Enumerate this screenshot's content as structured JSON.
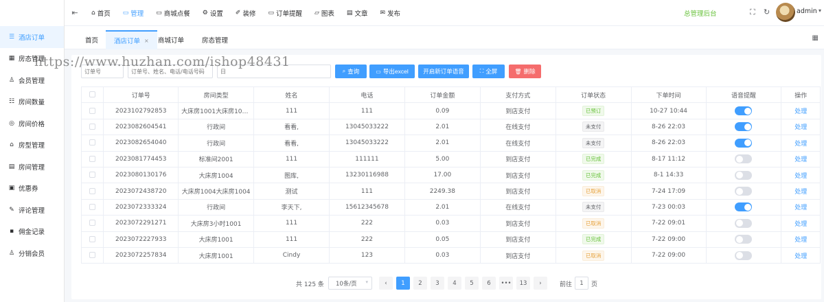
{
  "sidebar": {
    "items": [
      {
        "label": "酒店订单",
        "icon": "list-icon",
        "glyph": "☰",
        "active": true
      },
      {
        "label": "房态管理",
        "icon": "calendar-icon",
        "glyph": "▦",
        "active": false
      },
      {
        "label": "会员管理",
        "icon": "user-icon",
        "glyph": "♙",
        "active": false
      },
      {
        "label": "房间数量",
        "icon": "list-icon",
        "glyph": "☷",
        "active": false
      },
      {
        "label": "房间价格",
        "icon": "price-icon",
        "glyph": "◎",
        "active": false
      },
      {
        "label": "房型管理",
        "icon": "bank-icon",
        "glyph": "⌂",
        "active": false
      },
      {
        "label": "房间管理",
        "icon": "building-icon",
        "glyph": "▤",
        "active": false
      },
      {
        "label": "优惠券",
        "icon": "coupon-icon",
        "glyph": "▣",
        "active": false
      },
      {
        "label": "评论管理",
        "icon": "edit-icon",
        "glyph": "✎",
        "active": false
      },
      {
        "label": "佣金记录",
        "icon": "wallet-icon",
        "glyph": "▪",
        "active": false
      },
      {
        "label": "分销会员",
        "icon": "user-icon",
        "glyph": "♙",
        "active": false
      }
    ]
  },
  "topnav": {
    "collapse_glyph": "⇤",
    "items": [
      {
        "label": "首页",
        "icon": "home-icon",
        "glyph": "⌂"
      },
      {
        "label": "管理",
        "icon": "monitor-icon",
        "glyph": "▭",
        "active": true
      },
      {
        "label": "商城点餐",
        "icon": "message-icon",
        "glyph": "▭"
      },
      {
        "label": "设置",
        "icon": "gear-icon",
        "glyph": "⚙"
      },
      {
        "label": "装修",
        "icon": "brush-icon",
        "glyph": "✐"
      },
      {
        "label": "订单提醒",
        "icon": "bell-icon",
        "glyph": "▭"
      },
      {
        "label": "图表",
        "icon": "chart-icon",
        "glyph": "▱"
      },
      {
        "label": "文章",
        "icon": "document-icon",
        "glyph": "▤"
      },
      {
        "label": "发布",
        "icon": "wechat-icon",
        "glyph": "✉"
      }
    ],
    "brand": "总管理后台",
    "fullscreen_glyph": "⛶",
    "refresh_glyph": "↻",
    "user": "admin",
    "user_caret": "▾"
  },
  "tabs": {
    "items": [
      {
        "label": "首页",
        "active": false
      },
      {
        "label": "酒店订单",
        "active": true,
        "close": "×"
      },
      {
        "label": "商城订单",
        "active": false
      },
      {
        "label": "房态管理",
        "active": false
      }
    ],
    "grid_glyph": "▦"
  },
  "filters": {
    "order_no_placeholder": "订单号",
    "keyword_placeholder": "订单号、姓名、电话/电话号码",
    "date_placeholder": "日"
  },
  "buttons": {
    "query": "查询",
    "export": "导出excel",
    "voice": "开启新订单语音",
    "fullscreen": "全屏",
    "delete": "删除"
  },
  "watermark": "https://www.huzhan.com/ishop48431",
  "table": {
    "headers": [
      "订单号",
      "房间类型",
      "姓名",
      "电话",
      "订单金额",
      "支付方式",
      "订单状态",
      "下单时间",
      "语音提醒",
      "操作"
    ],
    "rows": [
      {
        "order_no": "2023102792853",
        "room": "大床房1001大床房1004...",
        "name": "111",
        "phone": "111",
        "amount": "0.09",
        "pay": "到店支付",
        "status": "已预订",
        "status_color": "green",
        "time": "10-27 10:44",
        "voice": true,
        "action": "处理"
      },
      {
        "order_no": "2023082604541",
        "room": "行政间",
        "name": "看看,",
        "phone": "13045033222",
        "amount": "2.01",
        "pay": "在线支付",
        "status": "未支付",
        "status_color": "gray",
        "time": "8-26 22:03",
        "voice": true,
        "action": "处理"
      },
      {
        "order_no": "2023082654040",
        "room": "行政间",
        "name": "看看,",
        "phone": "13045033222",
        "amount": "2.01",
        "pay": "在线支付",
        "status": "未支付",
        "status_color": "gray",
        "time": "8-26 22:03",
        "voice": true,
        "action": "处理"
      },
      {
        "order_no": "2023081774453",
        "room": "标准间2001",
        "name": "111",
        "phone": "111111",
        "amount": "5.00",
        "pay": "到店支付",
        "status": "已完成",
        "status_color": "green",
        "time": "8-17 11:12",
        "voice": false,
        "action": "处理"
      },
      {
        "order_no": "2023080130176",
        "room": "大床房1004",
        "name": "图库,",
        "phone": "13230116988",
        "amount": "17.00",
        "pay": "到店支付",
        "status": "已完成",
        "status_color": "green",
        "time": "8-1 14:33",
        "voice": false,
        "action": "处理"
      },
      {
        "order_no": "2023072438720",
        "room": "大床房1004大床房1004",
        "name": "测试",
        "phone": "111",
        "amount": "2249.38",
        "pay": "到店支付",
        "status": "已取消",
        "status_color": "orange",
        "time": "7-24 17:09",
        "voice": false,
        "action": "处理"
      },
      {
        "order_no": "2023072333324",
        "room": "行政间",
        "name": "李天下,",
        "phone": "15612345678",
        "amount": "2.01",
        "pay": "在线支付",
        "status": "未支付",
        "status_color": "gray",
        "time": "7-23 00:03",
        "voice": true,
        "action": "处理"
      },
      {
        "order_no": "2023072291271",
        "room": "大床房3小时1001",
        "name": "111",
        "phone": "222",
        "amount": "0.03",
        "pay": "到店支付",
        "status": "已取消",
        "status_color": "orange",
        "time": "7-22 09:01",
        "voice": false,
        "action": "处理"
      },
      {
        "order_no": "2023072227933",
        "room": "大床房1001",
        "name": "111",
        "phone": "222",
        "amount": "0.05",
        "pay": "到店支付",
        "status": "已完成",
        "status_color": "green",
        "time": "7-22 09:00",
        "voice": false,
        "action": "处理"
      },
      {
        "order_no": "2023072257834",
        "room": "大床房1001",
        "name": "Cindy",
        "phone": "123",
        "amount": "0.03",
        "pay": "到店支付",
        "status": "已取消",
        "status_color": "orange",
        "time": "7-22 09:00",
        "voice": false,
        "action": "处理"
      }
    ]
  },
  "pagination": {
    "total": "共 125 条",
    "page_size": "10条/页",
    "prev": "‹",
    "pages": [
      "1",
      "2",
      "3",
      "4",
      "5",
      "6",
      "•••",
      "13"
    ],
    "current": "1",
    "next": "›",
    "goto_label": "前往",
    "goto_value": "1",
    "goto_unit": "页"
  },
  "colors": {
    "primary": "#409eff",
    "danger": "#f56c6c",
    "success": "#67c23a",
    "warning": "#e6a23c"
  }
}
